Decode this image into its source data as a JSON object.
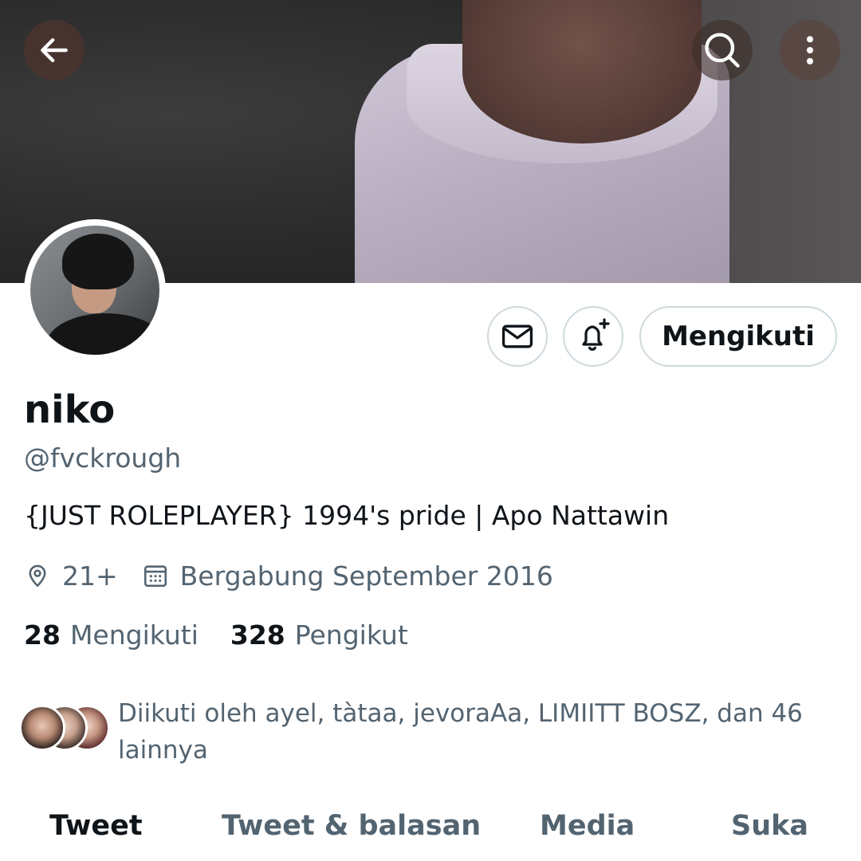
{
  "profile": {
    "display_name": "niko",
    "handle": "@fvckrough",
    "bio": "{JUST ROLEPLAYER} 1994's pride | Apo Nattawin",
    "location": "21+",
    "joined": "Bergabung September 2016"
  },
  "actions": {
    "follow_label": "Mengikuti"
  },
  "stats": {
    "following_count": "28",
    "following_label": "Mengikuti",
    "followers_count": "328",
    "followers_label": "Pengikut"
  },
  "followed_by": {
    "text": "Diikuti oleh ayel, tàtaa, jevoraAa, LIMIITT BOSZ, dan 46 lainnya"
  },
  "tabs": [
    {
      "label": "Tweet",
      "active": true
    },
    {
      "label": "Tweet & balasan",
      "active": false
    },
    {
      "label": "Media",
      "active": false
    },
    {
      "label": "Suka",
      "active": false
    }
  ],
  "icons": {
    "back": "arrow-left-icon",
    "search": "search-icon",
    "more": "more-vertical-icon",
    "message": "envelope-icon",
    "notify": "bell-plus-icon",
    "location": "location-pin-icon",
    "calendar": "calendar-icon"
  },
  "colors": {
    "text_primary": "#0f1419",
    "text_secondary": "#536471",
    "border": "#cfd9de"
  }
}
